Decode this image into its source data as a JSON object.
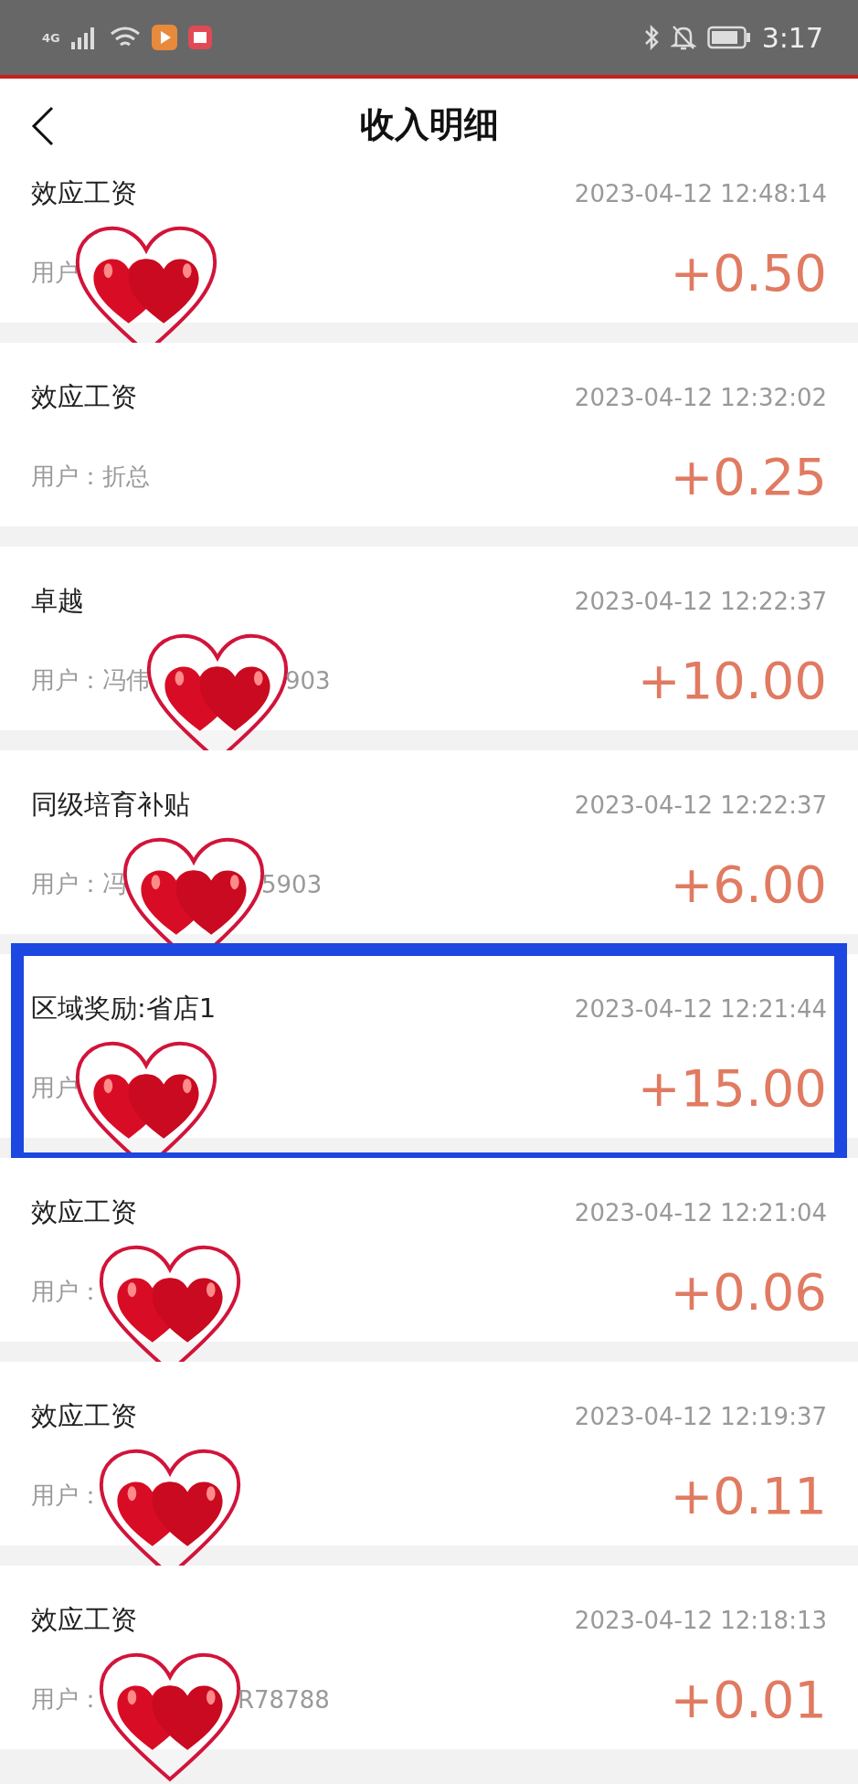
{
  "status_bar": {
    "network": "4G",
    "time": "3:17"
  },
  "header": {
    "title": "收入明细"
  },
  "records": [
    {
      "title": "效应工资",
      "time": "2023-04-12 12:48:14",
      "user_parts": [
        "用户"
      ],
      "masked": true,
      "amount": "+0.50",
      "highlighted": false,
      "cut": true
    },
    {
      "title": "效应工资",
      "time": "2023-04-12 12:32:02",
      "user_parts": [
        "用户：折总"
      ],
      "masked": false,
      "amount": "+0.25",
      "highlighted": false,
      "cut": false
    },
    {
      "title": "卓越",
      "time": "2023-04-12 12:22:37",
      "user_parts": [
        "用户：冯伟",
        "903"
      ],
      "masked": true,
      "amount": "+10.00",
      "highlighted": false,
      "cut": false
    },
    {
      "title": "同级培育补贴",
      "time": "2023-04-12 12:22:37",
      "user_parts": [
        "用户：冯",
        "5903"
      ],
      "masked": true,
      "amount": "+6.00",
      "highlighted": false,
      "cut": false
    },
    {
      "title": "区域奖励:省店1",
      "time": "2023-04-12 12:21:44",
      "user_parts": [
        "用户"
      ],
      "masked": true,
      "amount": "+15.00",
      "highlighted": true,
      "cut": false
    },
    {
      "title": "效应工资",
      "time": "2023-04-12 12:21:04",
      "user_parts": [
        "用户："
      ],
      "masked": true,
      "amount": "+0.06",
      "highlighted": false,
      "cut": false
    },
    {
      "title": "效应工资",
      "time": "2023-04-12 12:19:37",
      "user_parts": [
        "用户："
      ],
      "masked": true,
      "amount": "+0.11",
      "highlighted": false,
      "cut": false
    },
    {
      "title": "效应工资",
      "time": "2023-04-12 12:18:13",
      "user_parts": [
        "用户：",
        "R78788"
      ],
      "masked": true,
      "amount": "+0.01",
      "highlighted": false,
      "cut": false
    }
  ]
}
